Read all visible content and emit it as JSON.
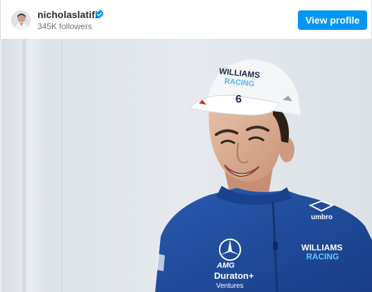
{
  "post_header": {
    "username": "nicholaslatifi",
    "verified_icon": "verified-badge-icon",
    "followers_text": "345K followers",
    "view_profile_label": "View profile"
  },
  "photo": {
    "cap": {
      "line1": "WILLIAMS",
      "line2": "RACING",
      "number": "6"
    },
    "shirt": {
      "brand": "umbro",
      "team_line1": "WILLIAMS",
      "team_line2": "RACING",
      "sponsor_mercedes": "AMG",
      "sponsor_doriton_line1": "Duraton+",
      "sponsor_doriton_line2": "Ventures"
    }
  },
  "colors": {
    "button_blue": "#0095f6",
    "verified_blue": "#0095f6",
    "jersey_blue": "#1f4a9c",
    "text_primary": "#262626",
    "text_secondary": "#737373"
  }
}
